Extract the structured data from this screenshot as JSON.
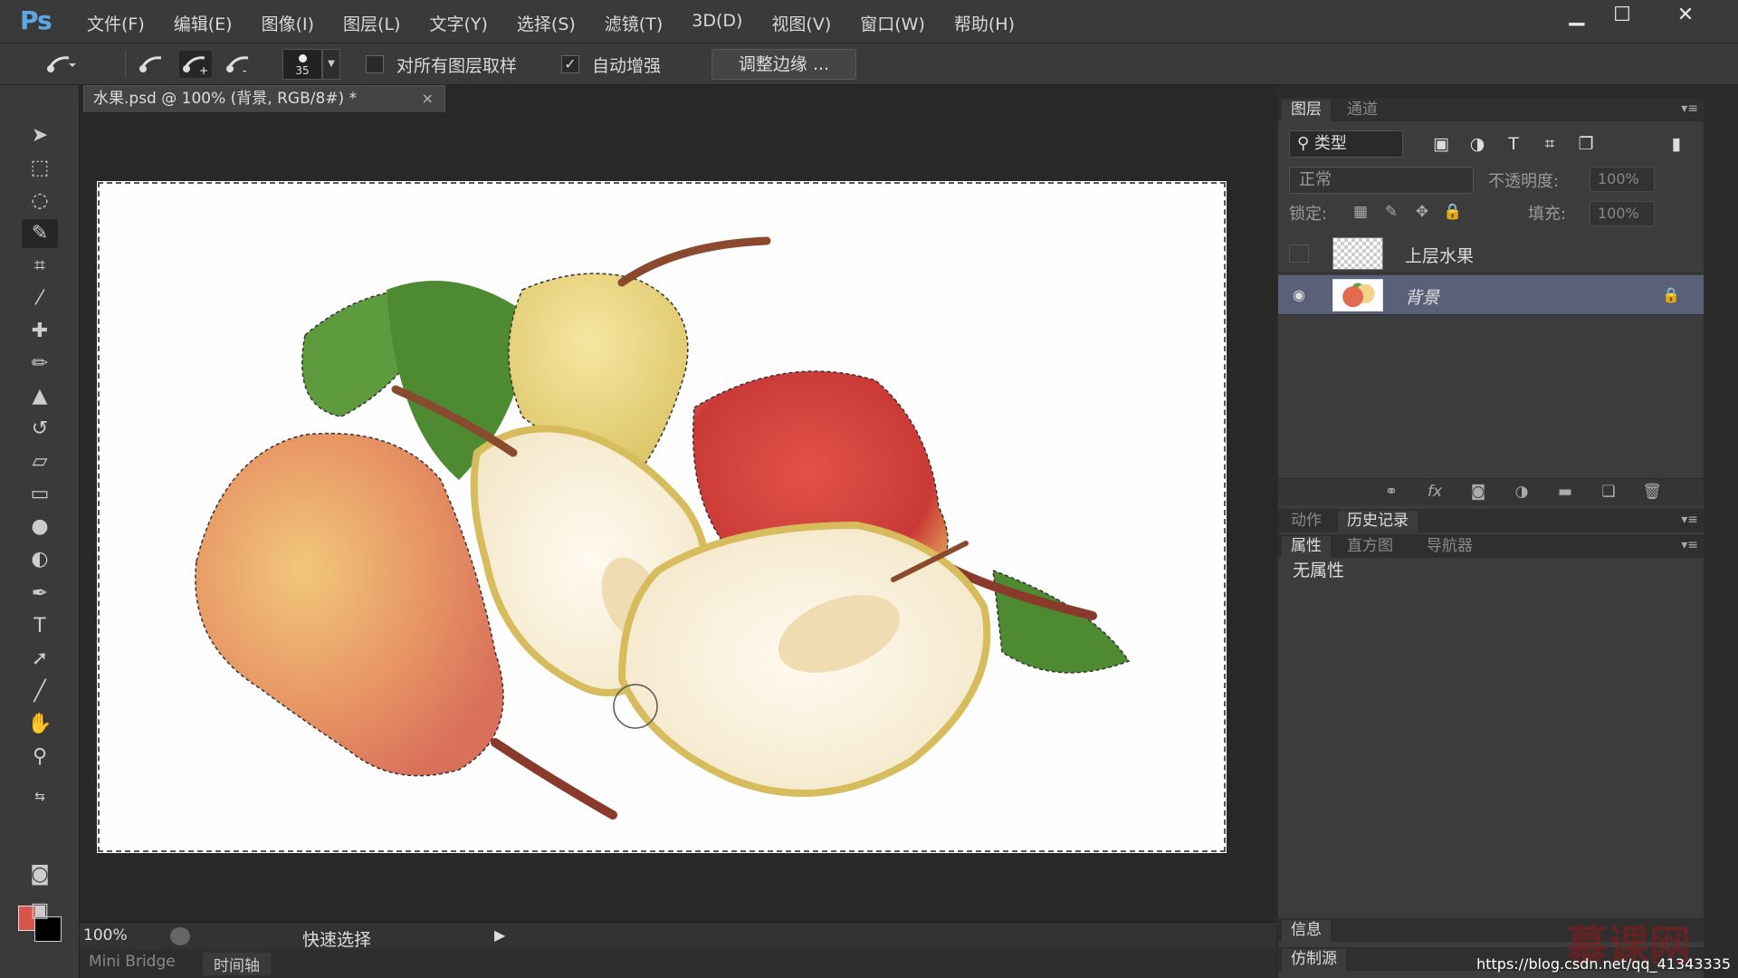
{
  "app": {
    "logo": "Ps"
  },
  "menu": [
    "文件(F)",
    "编辑(E)",
    "图像(I)",
    "图层(L)",
    "文字(Y)",
    "选择(S)",
    "滤镜(T)",
    "3D(D)",
    "视图(V)",
    "窗口(W)",
    "帮助(H)"
  ],
  "window_controls": {
    "minimize": "▁",
    "maximize": "☐",
    "close": "✕"
  },
  "options": {
    "brush_size": "35",
    "sample_all_layers_label": "对所有图层取样",
    "sample_all_layers_checked": false,
    "auto_enhance_label": "自动增强",
    "auto_enhance_checked": true,
    "refine_edge_label": "调整边缘 ..."
  },
  "document": {
    "tab_title": "水果.psd @ 100% (背景, RGB/8#) *",
    "close": "×"
  },
  "status": {
    "zoom": "100%",
    "tool_name": "快速选择",
    "arrow": "▶"
  },
  "bottom_tabs": [
    "Mini Bridge",
    "时间轴"
  ],
  "colors": {
    "foreground": "#d9554a",
    "background": "#000000",
    "selection": "#5a6078"
  },
  "layers_panel": {
    "tabs": [
      "图层",
      "通道"
    ],
    "filter_label": "类型",
    "blend_mode": "正常",
    "opacity_label": "不透明度:",
    "opacity_value": "100%",
    "lock_label": "锁定:",
    "fill_label": "填充:",
    "fill_value": "100%",
    "layers": [
      {
        "name": "上层水果",
        "visible": false,
        "locked": false
      },
      {
        "name": "背景",
        "visible": true,
        "locked": true,
        "selected": true
      }
    ]
  },
  "history_panel": {
    "tabs": [
      "动作",
      "历史记录"
    ]
  },
  "properties_panel": {
    "tabs": [
      "属性",
      "直方图",
      "导航器"
    ],
    "content": "无属性"
  },
  "info_panel": {
    "tabs": [
      "信息"
    ]
  },
  "clone_panel": {
    "tabs": [
      "仿制源"
    ]
  },
  "watermark": {
    "brand": "慕课网",
    "url": "https://blog.csdn.net/qq_41343335"
  }
}
